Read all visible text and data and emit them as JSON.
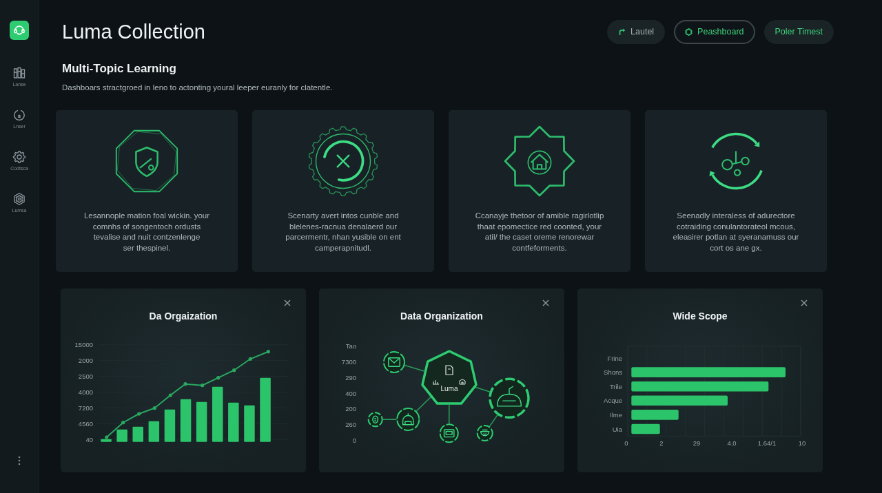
{
  "sidebar": {
    "items": [
      {
        "label": "Lanse"
      },
      {
        "label": "Lnser"
      },
      {
        "label": "Codtsca"
      },
      {
        "label": "Lumsa"
      }
    ]
  },
  "header": {
    "title": "Luma Collection",
    "buttons": [
      {
        "label": "Lautel",
        "kind": "link",
        "selected": false
      },
      {
        "label": "Peashboard",
        "kind": "icon",
        "selected": true
      },
      {
        "label": "Poler Timest",
        "kind": "text",
        "selected": false
      }
    ]
  },
  "section": {
    "title": "Multi-Topic Learning",
    "description": "Dashboars stractgroed in leno to actonting youral leeper euranly for clatentle."
  },
  "topic_cards": [
    {
      "lines": [
        "Lesannople mation foal wickin. your",
        "comnhs of songentoch ordusts",
        "tevalise and nuit contzenlenge",
        "ser thespinel."
      ]
    },
    {
      "lines": [
        "Scenarty avert intos cunble and",
        "blelenes-racnua denalaerd our",
        "parcermentr, nhan yusible on ent",
        "camperapnitudl."
      ]
    },
    {
      "lines": [
        "Ccanayje thetoor of amible ragirlotlip",
        "thaat epomectice red coonted, your",
        "atil/ the caset oreme renorewar",
        "contfeforments."
      ]
    },
    {
      "lines": [
        "Seenadly interaless of adurectore",
        "cotraiding conulantorateol mcous,",
        "eleasirer potlan at syeranamuss our",
        "cort os ane gx."
      ]
    }
  ],
  "panels": [
    {
      "kind": "combo",
      "title": "Da Orgaization",
      "axis_labels": [
        "15000",
        "2000",
        "2500",
        "4000",
        "7200",
        "4560",
        "40"
      ]
    },
    {
      "kind": "network",
      "title": "Data Organization",
      "axis_labels": [
        "Tao",
        "7300",
        "290",
        "400",
        "200",
        "260",
        "0"
      ],
      "hub_label": "Luma"
    },
    {
      "kind": "hbar",
      "title": "Wide Scope",
      "categories": [
        "Frine",
        "Shons",
        "Trile",
        "Acque",
        "Ilme",
        "Uia"
      ],
      "tick_labels": [
        "0",
        "2",
        "29",
        "4.0",
        "1.64/1",
        "10"
      ]
    }
  ]
}
